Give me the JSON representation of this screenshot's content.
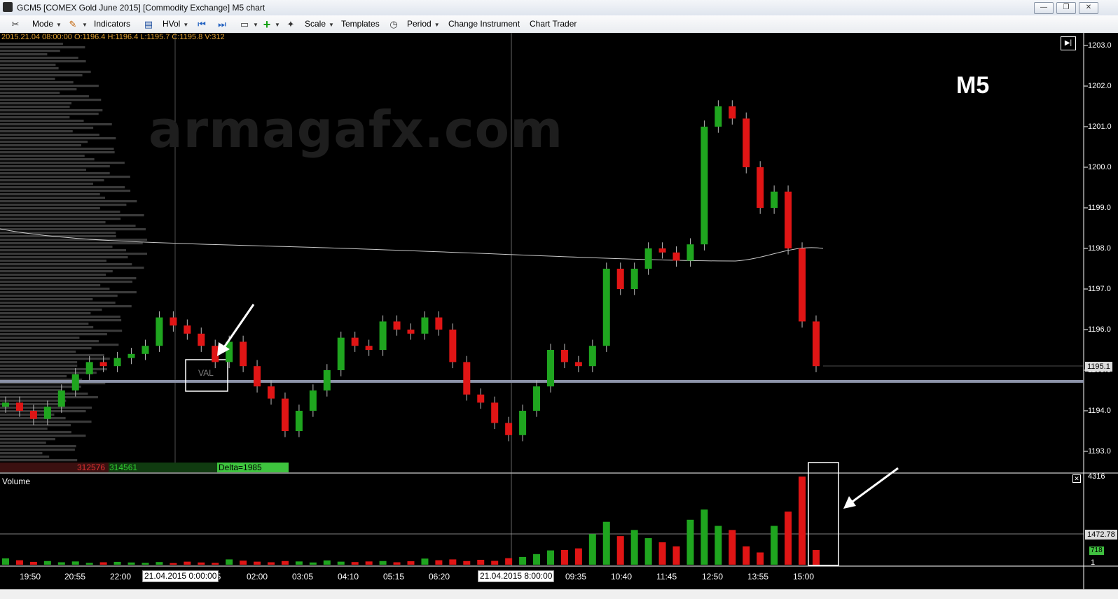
{
  "window": {
    "title": "GCM5 [COMEX Gold June 2015] [Commodity Exchange] M5 chart",
    "minimize_glyph": "—",
    "restore_glyph": "❐",
    "close_glyph": "✕"
  },
  "toolbar": {
    "mode": "Mode",
    "indicators": "Indicators",
    "hvol": "HVol",
    "scale": "Scale",
    "templates": "Templates",
    "period": "Period",
    "change_instrument": "Change Instrument",
    "chart_trader": "Chart Trader"
  },
  "chart": {
    "ohlc_line": "2015.21.04 08:00:00   O:1196.4   H:1196.4   L:1195.7   C:1195.8   V:312",
    "watermark": "armagafx.com",
    "timeframe_label": "M5",
    "val_label": "VAL",
    "sell_volume": "312576",
    "buy_volume": "314561",
    "delta": "Delta=1985",
    "volume_label": "Volume",
    "current_price": "1195.1",
    "price_ticks": [
      "1203.0",
      "1202.0",
      "1201.0",
      "1200.0",
      "1199.0",
      "1198.0",
      "1197.0",
      "1196.0",
      "1195.0",
      "1194.0",
      "1193.0"
    ],
    "time_ticks": [
      "19:50",
      "20:55",
      "22:00",
      "55",
      "02:00",
      "03:05",
      "04:10",
      "05:15",
      "06:20",
      "09:35",
      "10:40",
      "11:45",
      "12:50",
      "13:55",
      "15:00"
    ],
    "date_tag_1": "21.04.2015 0:00:00",
    "date_tag_2": "21.04.2015 8:00:00",
    "volume_max": "4316",
    "volume_mid": "1472.78",
    "volume_last": "718",
    "volume_min": "1",
    "colors": {
      "up": "#1fa51f",
      "down": "#e01515",
      "background": "#000000",
      "val_line": "#8c93a8"
    }
  },
  "chart_data": {
    "type": "candlestick",
    "title": "",
    "ylim": [
      1192.8,
      1203.3
    ],
    "ohlc_samples": [
      1194.2,
      1194.0,
      1193.8,
      1194.1,
      1194.5,
      1194.9,
      1195.2,
      1195.1,
      1195.3,
      1195.4,
      1195.6,
      1196.3,
      1196.1,
      1195.9,
      1195.6,
      1195.2,
      1195.7,
      1195.1,
      1194.6,
      1194.3,
      1193.5,
      1194.0,
      1194.5,
      1195.0,
      1195.8,
      1195.6,
      1195.5,
      1196.2,
      1196.0,
      1195.9,
      1196.3,
      1196.0,
      1195.2,
      1194.4,
      1194.2,
      1193.7,
      1193.4,
      1194.0,
      1194.6,
      1195.5,
      1195.2,
      1195.1,
      1195.6,
      1197.5,
      1197.0,
      1197.5,
      1198.0,
      1197.9,
      1197.7,
      1198.1,
      1201.0,
      1201.5,
      1201.2,
      1200.0,
      1199.0,
      1199.4,
      1198.0,
      1196.2,
      1195.1
    ],
    "volume_samples": [
      310,
      220,
      140,
      180,
      120,
      160,
      90,
      120,
      140,
      110,
      90,
      130,
      80,
      150,
      110,
      90,
      260,
      200,
      150,
      120,
      180,
      160,
      110,
      210,
      150,
      130,
      160,
      180,
      120,
      170,
      300,
      220,
      260,
      180,
      240,
      190,
      320,
      380,
      520,
      700,
      720,
      800,
      1500,
      2100,
      1400,
      1700,
      1300,
      1100,
      900,
      2200,
      2700,
      1900,
      1700,
      900,
      600,
      1900,
      2600,
      4316,
      718
    ]
  }
}
